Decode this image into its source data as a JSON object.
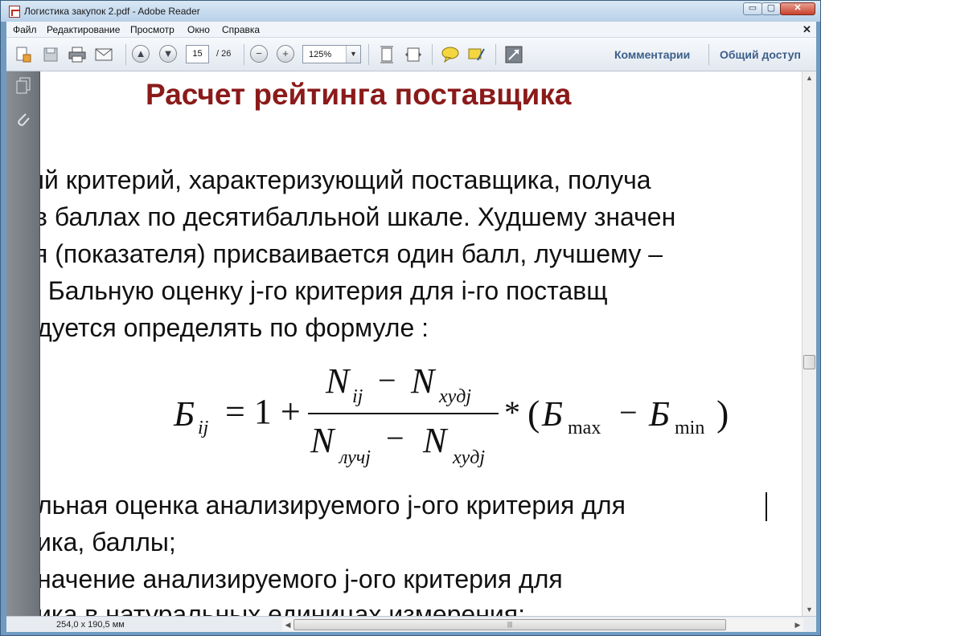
{
  "window": {
    "title": "Логистика закупок 2.pdf - Adobe Reader",
    "controls": {
      "minimize": "▭",
      "maximize": "▢",
      "close": "✕"
    }
  },
  "menu": {
    "items": [
      "Файл",
      "Редактирование",
      "Просмотр",
      "Окно",
      "Справка"
    ],
    "close": "✕"
  },
  "toolbar": {
    "page_current": "15",
    "page_total": "/ 26",
    "zoom": "125%",
    "links": {
      "comments": "Комментарии",
      "share": "Общий доступ"
    },
    "icons": [
      "create-pdf-icon",
      "save-icon",
      "print-icon",
      "email-icon",
      "prev-page-icon",
      "next-page-icon",
      "zoom-out-icon",
      "zoom-in-icon",
      "fit-page-icon",
      "fit-width-icon",
      "comment-icon",
      "highlight-icon",
      "full-screen-icon"
    ]
  },
  "document": {
    "heading": "Расчет рейтинга поставщика",
    "paragraph_lines": [
      "ый  критерий,  характеризующий  поставщика,  получа",
      "в баллах по десятибалльной шкале. Худшему значен",
      "я (показателя) присваивается один балл, лучшему –",
      ". Бальную  оценку  j-го  критерия  для  i-го  поставщ",
      "дуется определять по формуле :"
    ],
    "formula": {
      "lhs_symbol": "Б",
      "lhs_sub": "ij",
      "equals_one_plus": "= 1 +",
      "numerator": {
        "a": "N",
        "a_sub": "ij",
        "minus": "−",
        "b": "N",
        "b_sub": "худj"
      },
      "denominator": {
        "a": "N",
        "a_sub": "лучj",
        "minus": "−",
        "b": "N",
        "b_sub": "худj"
      },
      "multiply": "*",
      "factor": {
        "open": "(",
        "a": "Б",
        "a_sub": "max",
        "minus": "−",
        "b": "Б",
        "b_sub": "min",
        "close": ")"
      }
    },
    "definition_lines": [
      "льная  оценка  анализируемого  j-ого  критерия  для",
      "ика, баллы;",
      "начение    анализируемого    j-ого    критерия    для",
      "ика в натуральных единицах измерения;"
    ]
  },
  "status": {
    "page_size": "254,0 x 190,5 мм",
    "scroll_grip": "|||"
  },
  "colors": {
    "heading": "#8b1a1a",
    "frame": "#6f9bc2",
    "link": "#3c5f8a"
  }
}
